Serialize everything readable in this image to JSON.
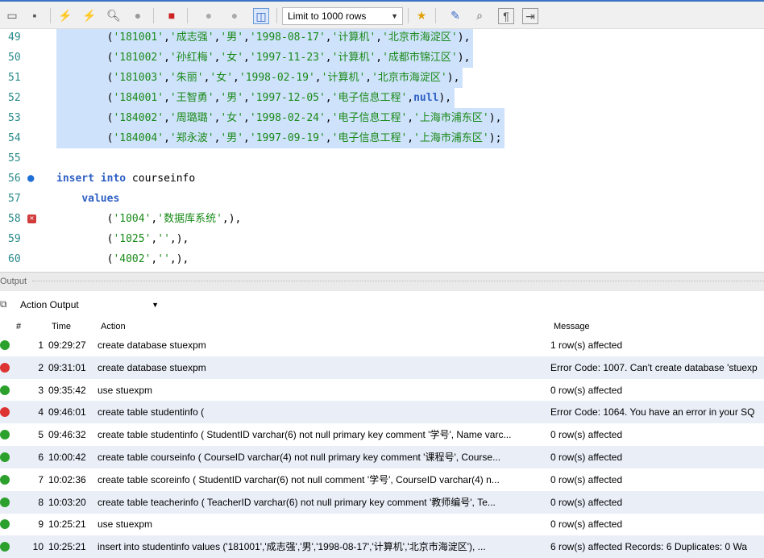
{
  "toolbar": {
    "limit_label": "Limit to 1000 rows",
    "icons": [
      "folder-open-icon",
      "save-icon",
      "execute-icon",
      "execute-current-icon",
      "explain-icon",
      "stop-icon",
      "toggle-autocommit-icon",
      "commit-icon",
      "rollback-icon",
      "toggle-output-icon",
      "limit-dropdown",
      "beautify-icon",
      "find-icon",
      "invisible-chars-icon",
      "wrap-icon"
    ]
  },
  "editor": {
    "lines": [
      {
        "num": "49",
        "text": "('181001','成志强','男','1998-08-17','计算机','北京市海淀区'),",
        "selected": true
      },
      {
        "num": "50",
        "text": "('181002','孙红梅','女','1997-11-23','计算机','成都市锦江区'),",
        "selected": true
      },
      {
        "num": "51",
        "text": "('181003','朱丽','女','1998-02-19','计算机','北京市海淀区'),",
        "selected": true
      },
      {
        "num": "52",
        "text": "('184001','王智勇','男','1997-12-05','电子信息工程',null),",
        "selected": true
      },
      {
        "num": "53",
        "text": "('184002','周璐璐','女','1998-02-24','电子信息工程','上海市浦东区'),",
        "selected": true
      },
      {
        "num": "54",
        "text": "('184004','郑永波','男','1997-09-19','电子信息工程','上海市浦东区');",
        "selected": true
      },
      {
        "num": "55",
        "text": "",
        "selected": false
      },
      {
        "num": "56",
        "text": "insert into courseinfo",
        "selected": false,
        "marker": "dot"
      },
      {
        "num": "57",
        "text": "values",
        "selected": false
      },
      {
        "num": "58",
        "text": "('1004','数据库系统',),",
        "selected": false,
        "marker": "err"
      },
      {
        "num": "59",
        "text": "('1025','',),",
        "selected": false
      },
      {
        "num": "60",
        "text": "('4002','',),",
        "selected": false
      }
    ]
  },
  "output": {
    "title": "Output",
    "selector_label": "Action Output",
    "columns": [
      "#",
      "Time",
      "Action",
      "Message"
    ],
    "rows": [
      {
        "n": "1",
        "time": "09:29:27",
        "action": "create database stuexpm",
        "msg": "1 row(s) affected",
        "status": "ok"
      },
      {
        "n": "2",
        "time": "09:31:01",
        "action": "create database stuexpm",
        "msg": "Error Code: 1007. Can't create database 'stuexp",
        "status": "err"
      },
      {
        "n": "3",
        "time": "09:35:42",
        "action": "use stuexpm",
        "msg": "0 row(s) affected",
        "status": "ok"
      },
      {
        "n": "4",
        "time": "09:46:01",
        "action": "create table studentinfo (",
        "msg": "Error Code: 1064. You have an error in your SQ",
        "status": "err"
      },
      {
        "n": "5",
        "time": "09:46:32",
        "action": "create table studentinfo ( StudentID varchar(6) not null primary key comment '学号', Name varc...",
        "msg": "0 row(s) affected",
        "status": "ok"
      },
      {
        "n": "6",
        "time": "10:00:42",
        "action": "create table courseinfo ( CourseID varchar(4) not null primary key comment '课程号',     Course...",
        "msg": "0 row(s) affected",
        "status": "ok"
      },
      {
        "n": "7",
        "time": "10:02:36",
        "action": "create table scoreinfo ( StudentID varchar(6) not null comment '学号',     CourseID varchar(4) n...",
        "msg": "0 row(s) affected",
        "status": "ok"
      },
      {
        "n": "8",
        "time": "10:03:20",
        "action": "create table teacherinfo ( TeacherID varchar(6) not null primary key comment '教师编号',     Te...",
        "msg": "0 row(s) affected",
        "status": "ok"
      },
      {
        "n": "9",
        "time": "10:25:21",
        "action": "use stuexpm",
        "msg": "0 row(s) affected",
        "status": "ok"
      },
      {
        "n": "10",
        "time": "10:25:21",
        "action": "insert into studentinfo values ('181001','成志强','男','1998-08-17','计算机','北京市海淀区'),    ...",
        "msg": "6 row(s) affected Records: 6  Duplicates: 0  Wa",
        "status": "ok"
      }
    ]
  }
}
